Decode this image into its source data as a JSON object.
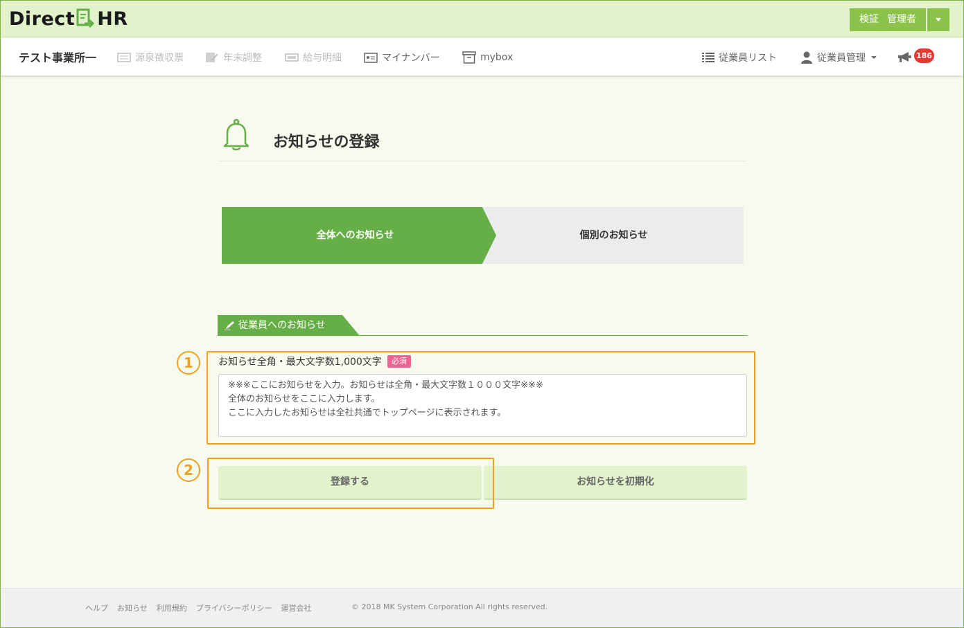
{
  "header": {
    "logo_left": "Direct",
    "logo_right": "HR",
    "admin_labels": [
      "検証",
      "管理者"
    ]
  },
  "nav": {
    "company": "テスト事業所一",
    "items": [
      {
        "label": "源泉徴収票",
        "icon": "receipt-icon",
        "enabled": false
      },
      {
        "label": "年末調整",
        "icon": "edit-document-icon",
        "enabled": false
      },
      {
        "label": "給与明細",
        "icon": "payslip-icon",
        "enabled": false
      },
      {
        "label": "マイナンバー",
        "icon": "id-card-icon",
        "enabled": true
      },
      {
        "label": "mybox",
        "icon": "archive-box-icon",
        "enabled": true
      }
    ],
    "employee_list": "従業員リスト",
    "employee_manage": "従業員管理",
    "notification_count": "186"
  },
  "page": {
    "title": "お知らせの登録",
    "steps": [
      "全体へのお知らせ",
      "個別のお知らせ"
    ],
    "section_title": "従業員へのお知らせ",
    "field_label": "お知らせ全角・最大文字数1,000文字",
    "required_badge": "必須",
    "textarea_lines": [
      "※※※ここにお知らせを入力。お知らせは全角・最大文字数１０００文字※※※",
      "全体のお知らせをここに入力します。",
      "ここに入力したお知らせは全社共通でトップページに表示されます。"
    ],
    "submit_label": "登録する",
    "reset_label": "お知らせを初期化",
    "annotations": [
      "1",
      "2"
    ]
  },
  "footer": {
    "links": [
      "ヘルプ",
      "お知らせ",
      "利用規約",
      "プライバシーポリシー",
      "運営会社"
    ],
    "copyright": "© 2018 MK System Corporation All rights reserved."
  },
  "colors": {
    "brand_green": "#66af47",
    "header_bg": "#e2f2cb",
    "admin_btn": "#8bc34a",
    "annotation_orange": "#f0a01c",
    "badge_red": "#e53935",
    "required_pink": "#f06292"
  }
}
